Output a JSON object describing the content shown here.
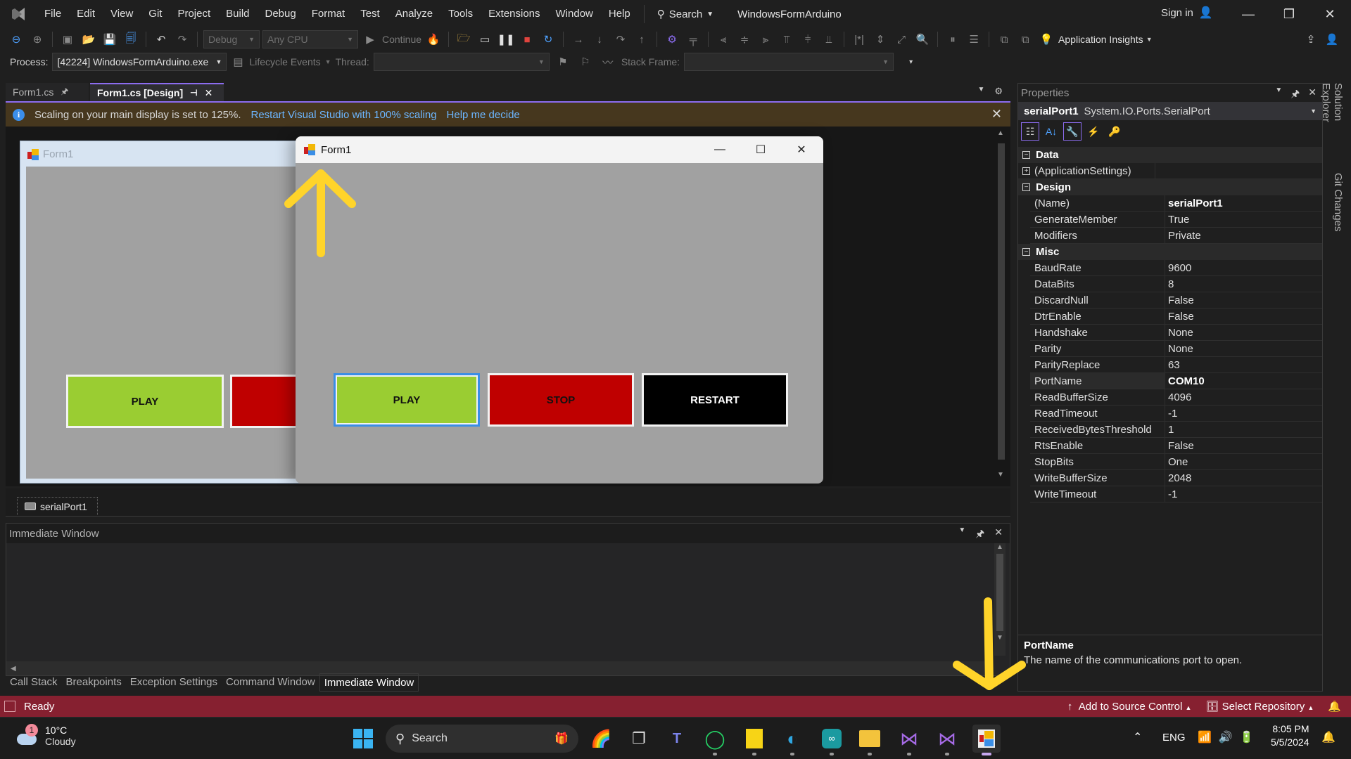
{
  "titlebar": {
    "menu": [
      "File",
      "Edit",
      "View",
      "Git",
      "Project",
      "Build",
      "Debug",
      "Format",
      "Test",
      "Analyze",
      "Tools",
      "Extensions",
      "Window",
      "Help"
    ],
    "search_label": "Search",
    "solution_name": "WindowsFormArduino",
    "sign_in": "Sign in"
  },
  "toolbar": {
    "config": "Debug",
    "platform": "Any CPU",
    "continue_label": "Continue",
    "app_insights": "Application Insights"
  },
  "debug_location": {
    "process_label": "Process:",
    "process_value": "[42224] WindowsFormArduino.exe",
    "lifecycle_label": "Lifecycle Events",
    "thread_label": "Thread:",
    "thread_value": "",
    "stack_frame_label": "Stack Frame:",
    "stack_frame_value": ""
  },
  "doc_tabs": [
    {
      "label": "Form1.cs",
      "active": false
    },
    {
      "label": "Form1.cs [Design]",
      "active": true
    }
  ],
  "infobar": {
    "message": "Scaling on your main display is set to 125%.",
    "link1": "Restart Visual Studio with 100% scaling",
    "link2": "Help me decide"
  },
  "design_form": {
    "title": "Form1",
    "buttons": [
      {
        "label": "PLAY",
        "color": "#9acd32"
      },
      {
        "label": "",
        "color": "#bf0000"
      }
    ]
  },
  "running_form": {
    "title": "Form1",
    "buttons": [
      {
        "label": "PLAY",
        "color": "#9acd32"
      },
      {
        "label": "STOP",
        "color": "#bf0000"
      },
      {
        "label": "RESTART",
        "color": "#000000"
      }
    ]
  },
  "component_tray": {
    "items": [
      "serialPort1"
    ]
  },
  "immediate_window": {
    "title": "Immediate Window",
    "content": ""
  },
  "bottom_tabs": [
    {
      "label": "Call Stack",
      "active": false
    },
    {
      "label": "Breakpoints",
      "active": false
    },
    {
      "label": "Exception Settings",
      "active": false
    },
    {
      "label": "Command Window",
      "active": false
    },
    {
      "label": "Immediate Window",
      "active": true
    }
  ],
  "properties": {
    "title": "Properties",
    "object_name": "serialPort1",
    "object_type": "System.IO.Ports.SerialPort",
    "categories": [
      {
        "name": "Data",
        "expanded": true,
        "rows": [
          {
            "name": "(ApplicationSettings)",
            "value": "",
            "expandable": true
          }
        ]
      },
      {
        "name": "Design",
        "expanded": true,
        "rows": [
          {
            "name": "(Name)",
            "value": "serialPort1",
            "bold": true
          },
          {
            "name": "GenerateMember",
            "value": "True"
          },
          {
            "name": "Modifiers",
            "value": "Private"
          }
        ]
      },
      {
        "name": "Misc",
        "expanded": true,
        "rows": [
          {
            "name": "BaudRate",
            "value": "9600"
          },
          {
            "name": "DataBits",
            "value": "8"
          },
          {
            "name": "DiscardNull",
            "value": "False"
          },
          {
            "name": "DtrEnable",
            "value": "False"
          },
          {
            "name": "Handshake",
            "value": "None"
          },
          {
            "name": "Parity",
            "value": "None"
          },
          {
            "name": "ParityReplace",
            "value": "63"
          },
          {
            "name": "PortName",
            "value": "COM10",
            "bold": true,
            "selected": true
          },
          {
            "name": "ReadBufferSize",
            "value": "4096"
          },
          {
            "name": "ReadTimeout",
            "value": "-1"
          },
          {
            "name": "ReceivedBytesThreshold",
            "value": "1"
          },
          {
            "name": "RtsEnable",
            "value": "False"
          },
          {
            "name": "StopBits",
            "value": "One"
          },
          {
            "name": "WriteBufferSize",
            "value": "2048"
          },
          {
            "name": "WriteTimeout",
            "value": "-1"
          }
        ]
      }
    ],
    "description_title": "PortName",
    "description_text": "The name of the communications port to open."
  },
  "side_tabs": [
    "Solution Explorer",
    "Git Changes"
  ],
  "statusbar": {
    "status": "Ready",
    "source_control": "Add to Source Control",
    "repository": "Select Repository"
  },
  "taskbar": {
    "weather_temp": "10°C",
    "weather_desc": "Cloudy",
    "weather_badge": "1",
    "search_label": "Search",
    "language": "ENG",
    "time": "8:05 PM",
    "date": "5/5/2024"
  },
  "colors": {
    "accent": "#8c6cf0",
    "statusbar": "#862030",
    "infobar": "#46371e",
    "annotation_arrow": "#ffd42a"
  }
}
